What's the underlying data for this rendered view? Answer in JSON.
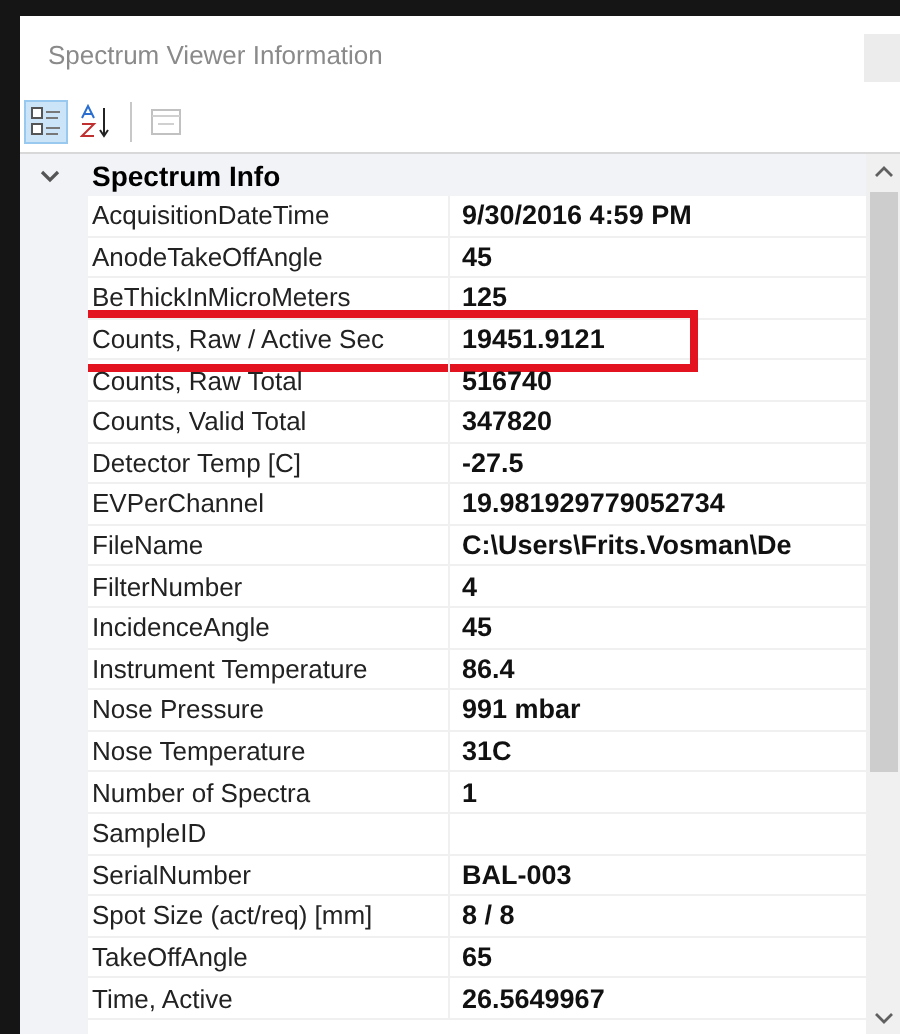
{
  "window": {
    "title": "Spectrum Viewer Information"
  },
  "toolbar": [
    {
      "kind": "categorized",
      "selected": true,
      "disabled": false
    },
    {
      "kind": "alphabetical",
      "selected": false,
      "disabled": false
    },
    {
      "kind": "property-pages",
      "selected": false,
      "disabled": true
    }
  ],
  "category": {
    "name": "Spectrum Info",
    "expanded": true
  },
  "properties": [
    {
      "name": "AcquisitionDateTime",
      "value": "9/30/2016 4:59 PM",
      "highlighted": false
    },
    {
      "name": "AnodeTakeOffAngle",
      "value": "45",
      "highlighted": false
    },
    {
      "name": "BeThickInMicroMeters",
      "value": "125",
      "highlighted": false
    },
    {
      "name": "Counts, Raw / Active Sec",
      "value": "19451.9121",
      "highlighted": true
    },
    {
      "name": "Counts, Raw Total",
      "value": "516740",
      "highlighted": false
    },
    {
      "name": "Counts, Valid Total",
      "value": "347820",
      "highlighted": false
    },
    {
      "name": "Detector Temp [C]",
      "value": "-27.5",
      "highlighted": false
    },
    {
      "name": "EVPerChannel",
      "value": "19.981929779052734",
      "highlighted": false
    },
    {
      "name": "FileName",
      "value": "C:\\Users\\Frits.Vosman\\De",
      "highlighted": false
    },
    {
      "name": "FilterNumber",
      "value": "4",
      "highlighted": false
    },
    {
      "name": "IncidenceAngle",
      "value": "45",
      "highlighted": false
    },
    {
      "name": "Instrument Temperature",
      "value": "86.4",
      "highlighted": false
    },
    {
      "name": "Nose Pressure",
      "value": "991 mbar",
      "highlighted": false
    },
    {
      "name": "Nose Temperature",
      "value": "31C",
      "highlighted": false
    },
    {
      "name": "Number of Spectra",
      "value": "1",
      "highlighted": false
    },
    {
      "name": "SampleID",
      "highlighted": false
    },
    {
      "name": "SerialNumber",
      "value": "BAL-003",
      "highlighted": false
    },
    {
      "name": "Spot Size (act/req) [mm]",
      "value": "8 / 8",
      "highlighted": false
    },
    {
      "name": "TakeOffAngle",
      "value": "65",
      "highlighted": false
    },
    {
      "name": "Time, Active",
      "value": "26.5649967",
      "highlighted": false
    }
  ]
}
